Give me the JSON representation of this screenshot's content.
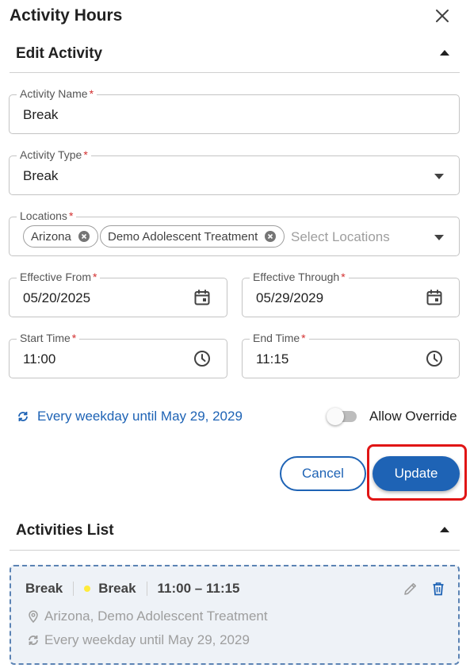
{
  "header": {
    "title": "Activity Hours"
  },
  "edit_section": {
    "title": "Edit Activity",
    "fields": {
      "activity_name": {
        "label": "Activity Name",
        "value": "Break"
      },
      "activity_type": {
        "label": "Activity Type",
        "value": "Break"
      },
      "locations": {
        "label": "Locations",
        "chips": [
          "Arizona",
          "Demo Adolescent Treatment"
        ],
        "placeholder": "Select Locations"
      },
      "effective_from": {
        "label": "Effective From",
        "value": "05/20/2025"
      },
      "effective_through": {
        "label": "Effective Through",
        "value": "05/29/2029"
      },
      "start_time": {
        "label": "Start Time",
        "value": "11:00"
      },
      "end_time": {
        "label": "End Time",
        "value": "11:15"
      }
    },
    "required_mark": "*",
    "recurrence": "Every weekday until May 29, 2029",
    "allow_override": {
      "label": "Allow Override",
      "checked": false
    },
    "cancel_label": "Cancel",
    "update_label": "Update"
  },
  "list_section": {
    "title": "Activities List",
    "items": [
      {
        "name": "Break",
        "type": "Break",
        "time": "11:00 – 11:15",
        "locations": "Arizona, Demo Adolescent Treatment",
        "recurrence": "Every weekday until May 29, 2029"
      }
    ]
  },
  "colors": {
    "accent": "#1e63b5",
    "required": "#d32f2f",
    "highlight": "#e01515",
    "type_dot": "#ffeb3b"
  }
}
